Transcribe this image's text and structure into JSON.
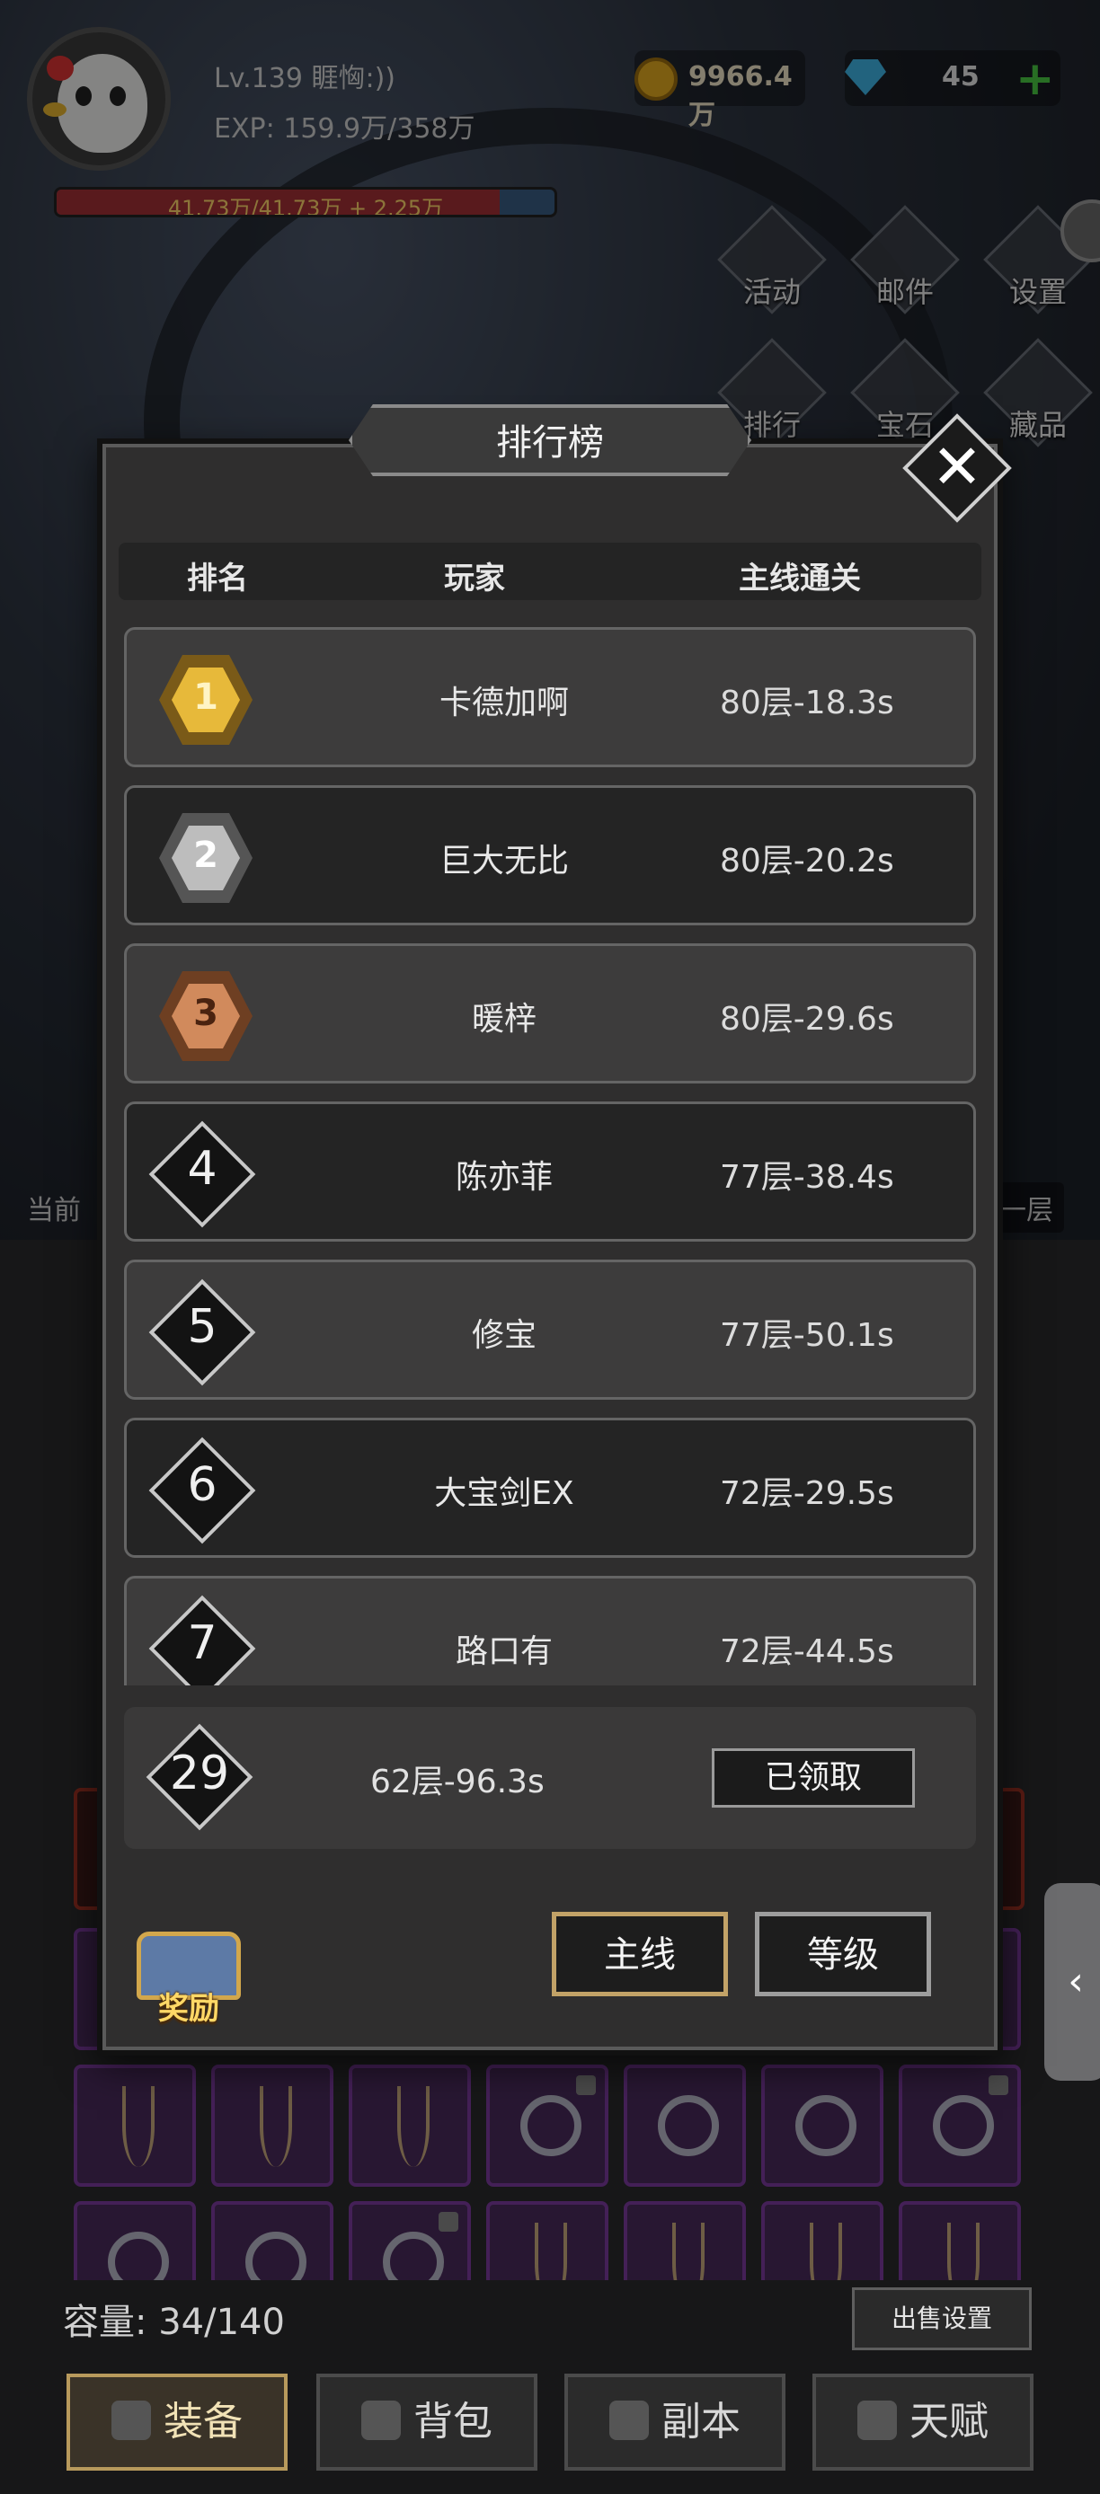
{
  "header": {
    "player_name": "Lv.139 睚恟:))",
    "exp": "EXP: 159.9万/358万",
    "hp_text": "41.73万/41.73万 + 2.25万",
    "hp_fill_fraction": 0.89,
    "gold": "9966.4万",
    "gems": "45",
    "plus": "+"
  },
  "menu": {
    "activity": "活动",
    "mail": "邮件",
    "settings": "设置",
    "ranking": "排行",
    "gem": "宝石",
    "collection": "藏品"
  },
  "background": {
    "current_label": "当前",
    "layer_label": "一层"
  },
  "modal": {
    "title": "排行榜",
    "close": "✕",
    "columns": {
      "rank": "排名",
      "player": "玩家",
      "progress": "主线通关"
    },
    "rows": [
      {
        "rank": "1",
        "name": "卡德加啊",
        "score": "80层-18.3s"
      },
      {
        "rank": "2",
        "name": "巨大无比",
        "score": "80层-20.2s"
      },
      {
        "rank": "3",
        "name": "暖梓",
        "score": "80层-29.6s"
      },
      {
        "rank": "4",
        "name": "陈亦菲",
        "score": "77层-38.4s"
      },
      {
        "rank": "5",
        "name": "修宝",
        "score": "77层-50.1s"
      },
      {
        "rank": "6",
        "name": "大宝剑EX",
        "score": "72层-29.5s"
      },
      {
        "rank": "7",
        "name": "路口有",
        "score": "72层-44.5s"
      }
    ],
    "me": {
      "rank": "29",
      "score": "62层-96.3s",
      "claim_label": "已领取"
    },
    "reward_label": "奖励",
    "tab_main": "主线",
    "tab_level": "等级"
  },
  "inventory": {
    "capacity": "容量: 34/140",
    "sell_settings": "出售设置"
  },
  "bottom_tabs": {
    "equip": "装备",
    "bag": "背包",
    "dungeon": "副本",
    "talent": "天赋"
  },
  "side_tab_arrow": "‹",
  "colors": {
    "gold_medal": "#e7b93a",
    "silver_medal": "#bdbdbd",
    "bronze_medal": "#d18a5c",
    "accent": "#c2a267"
  }
}
